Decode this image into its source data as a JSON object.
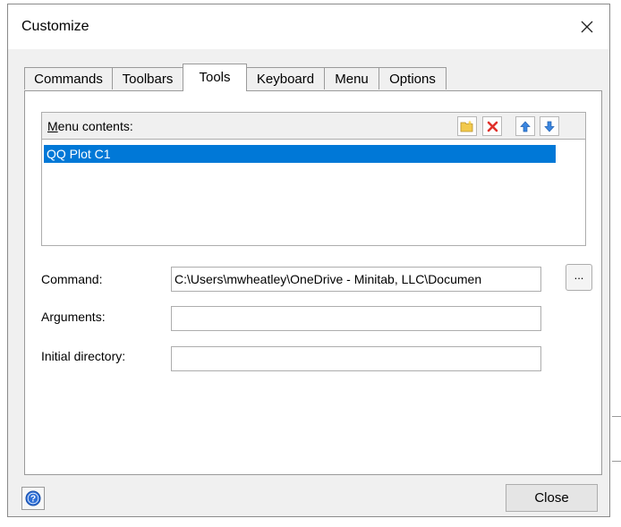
{
  "dialog": {
    "title": "Customize",
    "close_icon": "close-x-icon"
  },
  "tabs": [
    {
      "label": "Commands",
      "active": false
    },
    {
      "label": "Toolbars",
      "active": false
    },
    {
      "label": "Tools",
      "active": true
    },
    {
      "label": "Keyboard",
      "active": false
    },
    {
      "label": "Menu",
      "active": false
    },
    {
      "label": "Options",
      "active": false
    }
  ],
  "menu_contents": {
    "label_accel": "M",
    "label_rest": "enu contents:",
    "toolbar_icons": [
      "new-folder-icon",
      "delete-icon",
      "move-up-icon",
      "move-down-icon"
    ],
    "items": [
      "QQ Plot C1"
    ],
    "selected_color": "#0078d7"
  },
  "form": {
    "command_label": "Command:",
    "command_value": "C:\\Users\\mwheatley\\OneDrive - Minitab, LLC\\Documen",
    "browse_label": "...",
    "arguments_label": "Arguments:",
    "arguments_value": "",
    "initial_dir_label": "Initial directory:",
    "initial_dir_value": ""
  },
  "footer": {
    "help_icon": "help-icon",
    "close_label": "Close"
  }
}
